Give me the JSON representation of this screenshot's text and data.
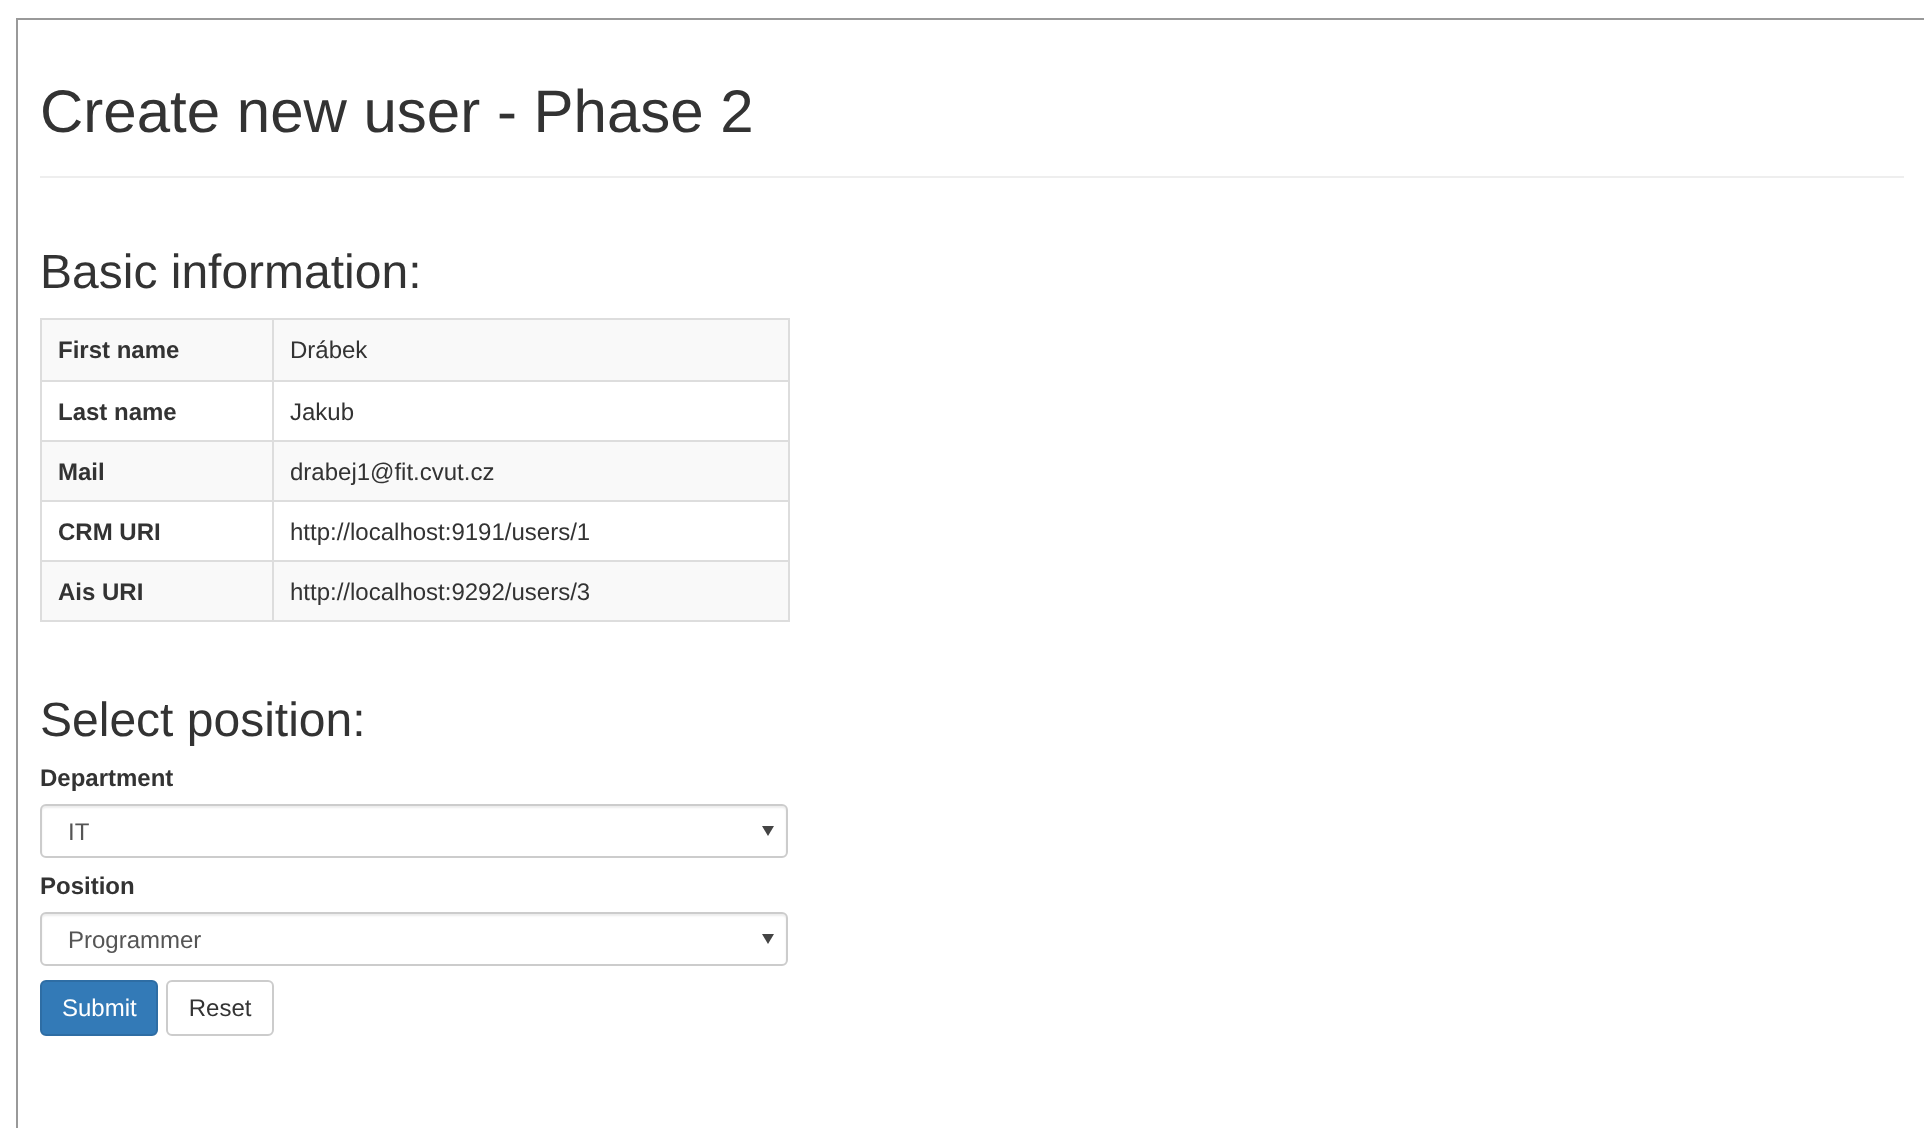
{
  "title": "Create new user - Phase 2",
  "basic_info": {
    "heading": "Basic information:",
    "rows": [
      {
        "label": "First name",
        "value": "Drábek"
      },
      {
        "label": "Last name",
        "value": "Jakub"
      },
      {
        "label": "Mail",
        "value": "drabej1@fit.cvut.cz"
      },
      {
        "label": "CRM URI",
        "value": "http://localhost:9191/users/1"
      },
      {
        "label": "Ais URI",
        "value": "http://localhost:9292/users/3"
      }
    ]
  },
  "position_form": {
    "heading": "Select position:",
    "fields": [
      {
        "label": "Department",
        "value": "IT"
      },
      {
        "label": "Position",
        "value": "Programmer"
      }
    ],
    "buttons": [
      {
        "label": "Submit",
        "kind": "primary"
      },
      {
        "label": "Reset",
        "kind": "default"
      }
    ]
  }
}
